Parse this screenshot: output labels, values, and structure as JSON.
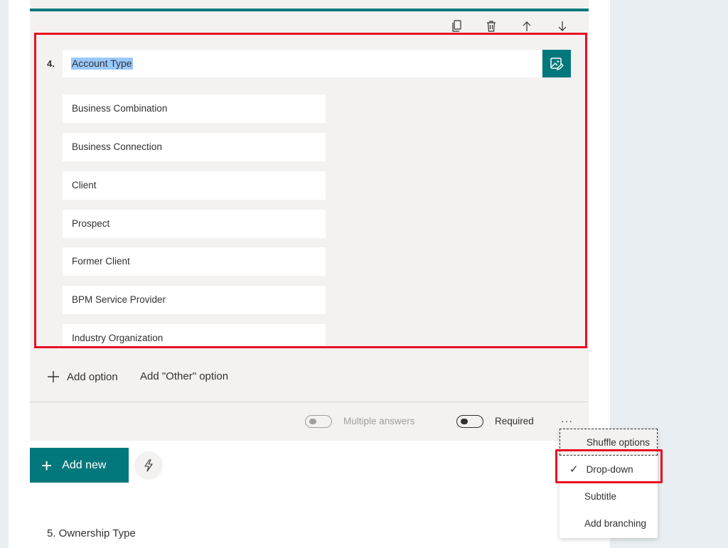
{
  "question": {
    "number": "4.",
    "title": "Account Type",
    "options": [
      "Business Combination",
      "Business Connection",
      "Client",
      "Prospect",
      "Former Client",
      "BPM Service Provider",
      "Industry Organization"
    ],
    "add_option_label": "Add option",
    "add_other_label": "Add \"Other\" option"
  },
  "footer": {
    "multiple_answers_label": "Multiple answers",
    "required_label": "Required",
    "more_label": "···"
  },
  "menu": {
    "shuffle_label": "Shuffle options",
    "dropdown_label": "Drop-down",
    "dropdown_checked": "✓",
    "subtitle_label": "Subtitle",
    "branching_label": "Add branching"
  },
  "add_new": {
    "plus": "+",
    "label": "Add new"
  },
  "next_question": {
    "title": "5. Ownership Type"
  },
  "colors": {
    "accent": "#03787c",
    "highlight": "#e81123",
    "selection": "#99c9ff"
  },
  "icons": [
    "copy-icon",
    "trash-icon",
    "arrow-up-icon",
    "arrow-down-icon",
    "image-edit-icon",
    "plus-icon",
    "lightning-icon",
    "checkmark-icon"
  ]
}
